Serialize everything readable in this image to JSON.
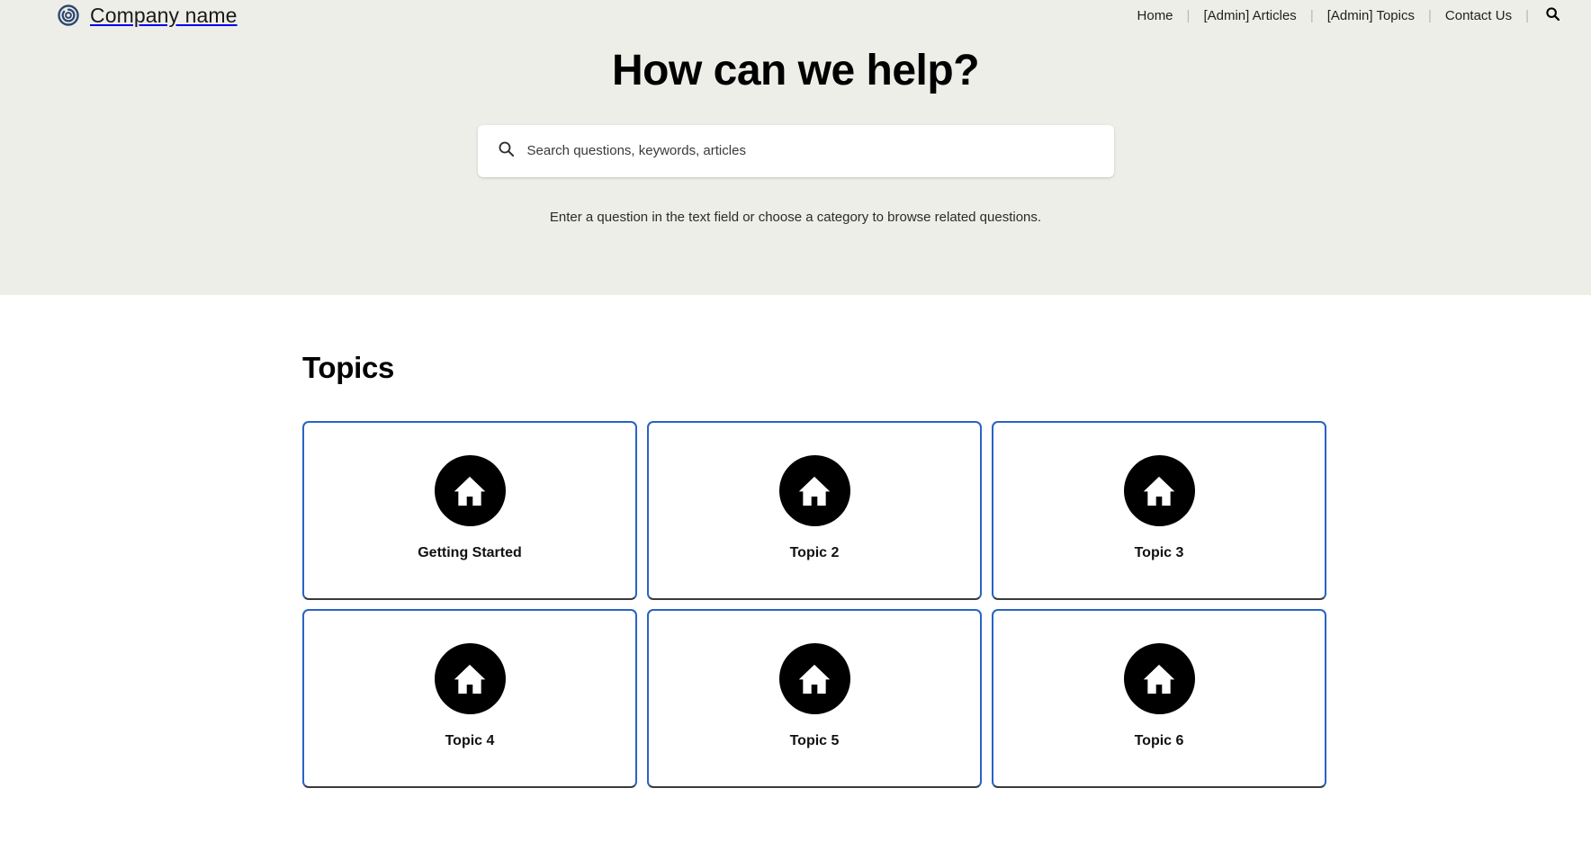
{
  "header": {
    "brand_name": "Company name",
    "logo_icon": "spiral-circle-logo",
    "logo_color": "#2c4870",
    "nav": [
      {
        "label": "Home",
        "name": "home"
      },
      {
        "label": "[Admin] Articles",
        "name": "admin-articles"
      },
      {
        "label": "[Admin] Topics",
        "name": "admin-topics"
      },
      {
        "label": "Contact Us",
        "name": "contact-us"
      }
    ],
    "separator": "|",
    "search_icon": "search-icon"
  },
  "hero": {
    "title": "How can we help?",
    "background_color": "#eeeee8",
    "search": {
      "icon": "search-icon",
      "placeholder": "Search questions, keywords, articles",
      "value": ""
    },
    "subtitle": "Enter a question in the text field or choose a category to browse related questions."
  },
  "topics": {
    "heading": "Topics",
    "card_border_color": "#2a63c4",
    "icon_background": "#000000",
    "items": [
      {
        "label": "Getting Started",
        "icon": "home-icon"
      },
      {
        "label": "Topic 2",
        "icon": "home-icon"
      },
      {
        "label": "Topic 3",
        "icon": "home-icon"
      },
      {
        "label": "Topic 4",
        "icon": "home-icon"
      },
      {
        "label": "Topic 5",
        "icon": "home-icon"
      },
      {
        "label": "Topic 6",
        "icon": "home-icon"
      }
    ]
  }
}
